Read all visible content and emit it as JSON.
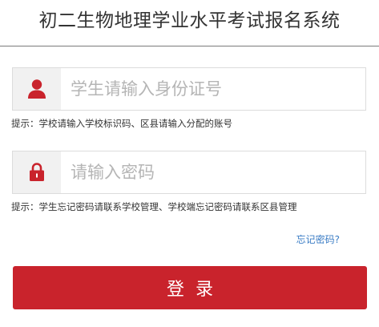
{
  "header": {
    "title": "初二生物地理学业水平考试报名系统"
  },
  "form": {
    "username": {
      "value": "",
      "placeholder": "学生请输入身份证号",
      "icon": "user-icon",
      "hint": "提示：学校请输入学校标识码、区县请输入分配的账号"
    },
    "password": {
      "value": "",
      "placeholder": "请输入密码",
      "icon": "lock-icon",
      "hint": "提示：学生忘记密码请联系学校管理、学校端忘记密码请联系区县管理"
    },
    "forgot_label": "忘记密码?",
    "login_label": "登录"
  },
  "colors": {
    "accent": "#c9232c",
    "link": "#3a7cc5",
    "icon_bg": "#f1f1f1"
  }
}
